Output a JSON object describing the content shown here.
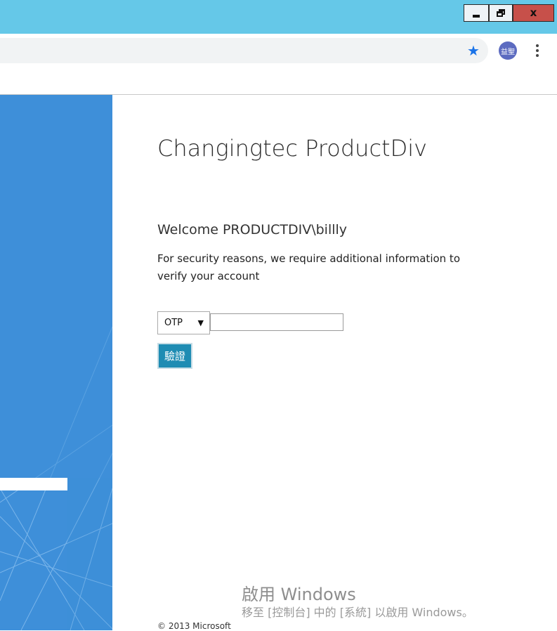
{
  "window": {
    "controls": {
      "minimize_icon": "minimize-icon",
      "maximize_icon": "restore-icon",
      "close_label": "x"
    },
    "titlebar_color": "#65c8e8",
    "close_color": "#c7504a"
  },
  "browser": {
    "bookmark_icon": "star-icon",
    "bookmark_glyph": "★",
    "bookmark_color": "#1a73e8",
    "profile_avatar_text": "益聖",
    "menu_icon": "vertical-dots-icon"
  },
  "login": {
    "title": "Changingtec ProductDiv",
    "welcome": "Welcome PRODUCTDIV\\billly",
    "security_message": "For security reasons, we require additional information to verify your account",
    "auth_method": {
      "selected": "OTP",
      "arrow": "▼"
    },
    "otp_value": "",
    "verify_button": "驗證",
    "verify_button_color": "#1f8cb3",
    "copyright": "© 2013 Microsoft"
  },
  "windows_activation": {
    "title": "啟用 Windows",
    "subtitle": "移至 [控制台] 中的 [系統] 以啟用 Windows。"
  },
  "left_panel": {
    "color": "#3e8fd9"
  }
}
